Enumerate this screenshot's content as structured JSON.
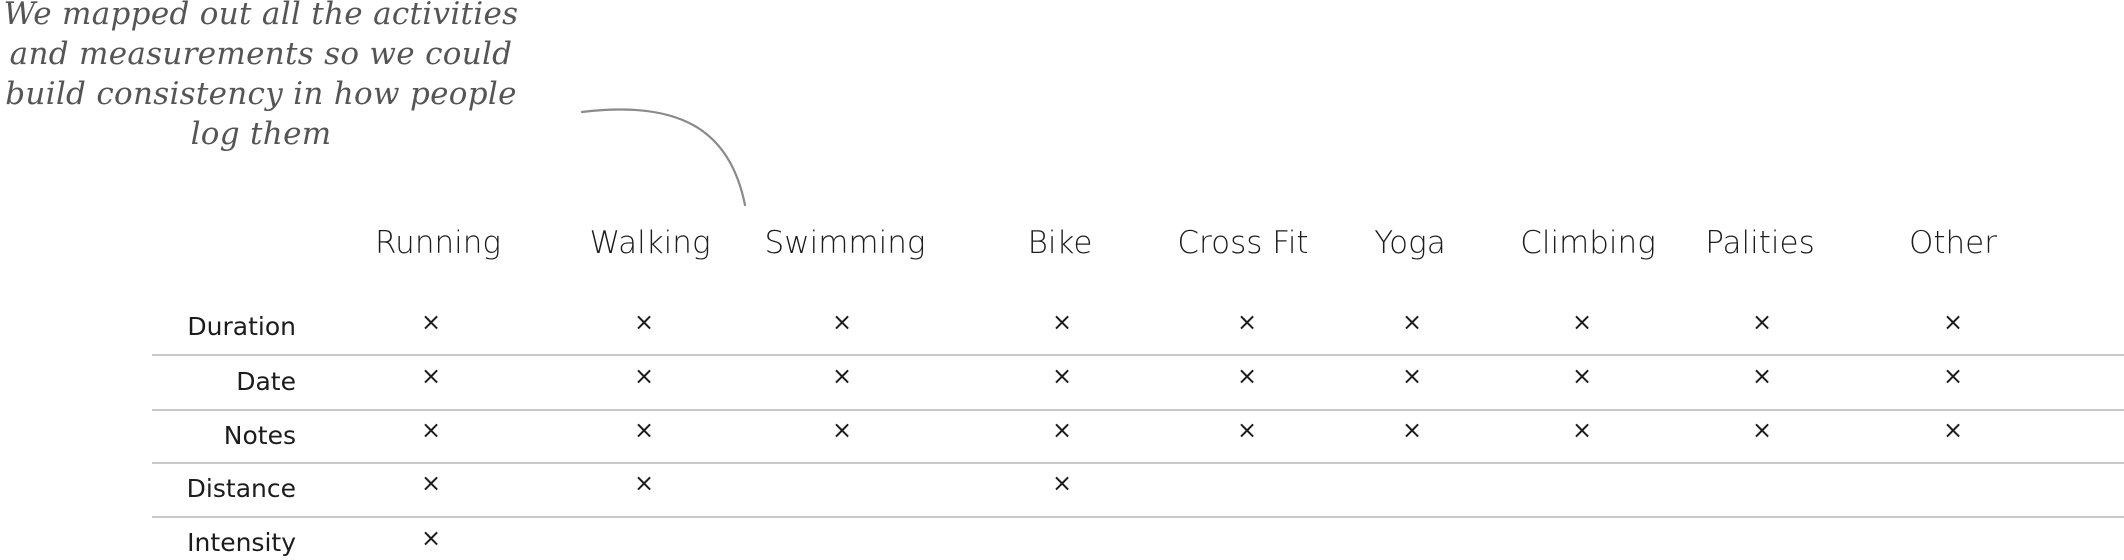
{
  "annotation": {
    "lines": [
      "We mapped out all the activities",
      "and measurements so we could",
      "build consistency in how people",
      "log them"
    ]
  },
  "matrix": {
    "activities": [
      "Running",
      "Walking",
      "Swimming",
      "Bike",
      "Cross Fit",
      "Yoga",
      "Climbing",
      "Palities",
      "Other"
    ],
    "mark_symbol": "×",
    "rows": [
      {
        "label": "Duration",
        "marks": [
          true,
          true,
          true,
          true,
          true,
          true,
          true,
          true,
          true
        ]
      },
      {
        "label": "Date",
        "marks": [
          true,
          true,
          true,
          true,
          true,
          true,
          true,
          true,
          true
        ]
      },
      {
        "label": "Notes",
        "marks": [
          true,
          true,
          true,
          true,
          true,
          true,
          true,
          true,
          true
        ]
      },
      {
        "label": "Distance",
        "marks": [
          true,
          true,
          false,
          true,
          false,
          false,
          false,
          false,
          false
        ]
      },
      {
        "label": "Intensity",
        "marks": [
          true,
          false,
          false,
          false,
          false,
          false,
          false,
          false,
          false
        ]
      }
    ]
  }
}
